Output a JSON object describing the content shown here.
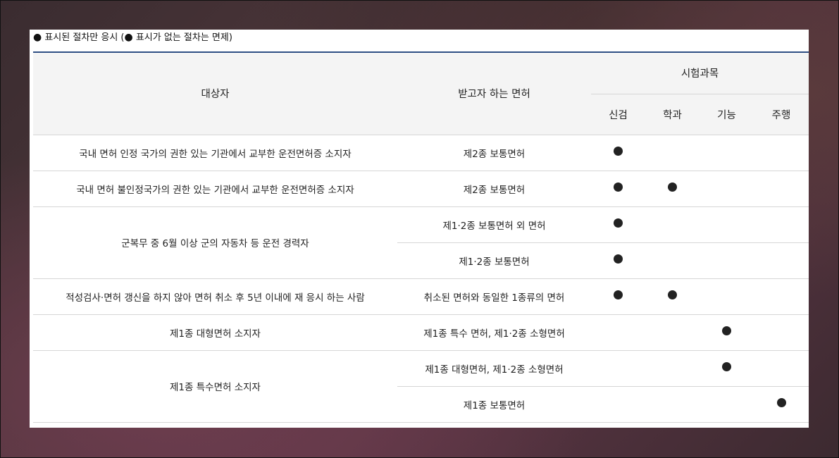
{
  "note": {
    "marker": "●",
    "text_a": " 표시된 절차만 응시 (",
    "text_b": " 표시가 없는 절차는 면제)"
  },
  "table": {
    "headers": {
      "target": "대상자",
      "license": "받고자 하는 면허",
      "subjects": "시험과목",
      "sub": [
        "신검",
        "학과",
        "기능",
        "주행"
      ]
    },
    "rows": [
      {
        "target": "국내 면허 인정 국가의 권한 있는 기관에서 교부한 운전면허증 소지자",
        "license": "제2종 보통면허",
        "marks": [
          true,
          false,
          false,
          false
        ]
      },
      {
        "target": "국내 면허 불인정국가의 권한 있는 기관에서 교부한 운전면허증 소지자",
        "license": "제2종 보통면허",
        "marks": [
          true,
          true,
          false,
          false
        ]
      },
      {
        "target": "군복무 중 6월 이상 군의 자동차 등 운전 경력자",
        "license": "제1·2종 보통면허 외 면허",
        "marks": [
          true,
          false,
          false,
          false
        ]
      },
      {
        "target": "",
        "license": "제1·2종 보통면허",
        "marks": [
          true,
          false,
          false,
          false
        ]
      },
      {
        "target": "적성검사·면허 갱신을 하지 않아 면허 취소 후 5년 이내에 재 응시 하는 사람",
        "license": "취소된 면허와 동일한 1종류의 면허",
        "marks": [
          true,
          true,
          false,
          false
        ]
      },
      {
        "target": "제1종 대형면허 소지자",
        "license": "제1종 특수 면허, 제1·2종 소형면허",
        "marks": [
          false,
          false,
          true,
          false
        ]
      },
      {
        "target": "제1종 특수면허 소지자",
        "license": "제1종 대형면허, 제1·2종 소형면허",
        "marks": [
          false,
          false,
          true,
          false
        ]
      },
      {
        "target": "",
        "license": "제1종 보통면허",
        "marks": [
          false,
          false,
          false,
          true
        ]
      }
    ]
  },
  "colors": {
    "header_border": "#2f4f84",
    "header_bg": "#f4f4f4"
  }
}
